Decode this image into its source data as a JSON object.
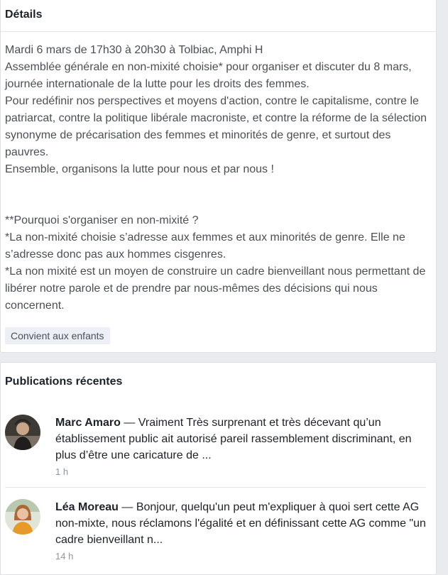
{
  "details": {
    "title": "Détails",
    "paragraph1": "Mardi 6 mars de 17h30 à 20h30 à Tolbiac, Amphi H\nAssemblée générale en non-mixité choisie* pour organiser et discuter du 8 mars, journée internationale de la lutte pour les droits des femmes.\nPour redéfinir nos perspectives et moyens d'action, contre le capitalisme, contre le patriarcat, contre la politique libérale macroniste, et contre la réforme de la sélection synonyme de précarisation des femmes et minorités de genre, et surtout des pauvres.\nEnsemble, organisons la lutte pour nous et par nous !",
    "paragraph2": "**Pourquoi s'organiser en non-mixité ?\n*La non-mixité choisie s’adresse aux femmes et aux minorités de genre. Elle ne s’adresse donc pas aux hommes cisgenres.\n*La non mixité est un moyen de construire un cadre bienveillant nous permettant de libérer notre parole et de prendre par nous-mêmes des décisions qui nous concernent.",
    "tag": "Convient aux enfants"
  },
  "recent": {
    "title": "Publications récentes",
    "posts": [
      {
        "author": "Marc Amaro",
        "separator": " — ",
        "text": "Vraiment Très surprenant et très décevant qu’un établissement public ait autorisé pareil rassemblement discriminant, en plus d’être une caricature de ...",
        "time": "1 h"
      },
      {
        "author": "Léa Moreau",
        "separator": " — ",
        "text": "Bonjour, quelqu'un peut m'expliquer à quoi sert cette AG non-mixte, nous réclamons l'égalité et en définissant cette AG comme \"un cadre bienveillant n...",
        "time": "14 h"
      }
    ]
  }
}
